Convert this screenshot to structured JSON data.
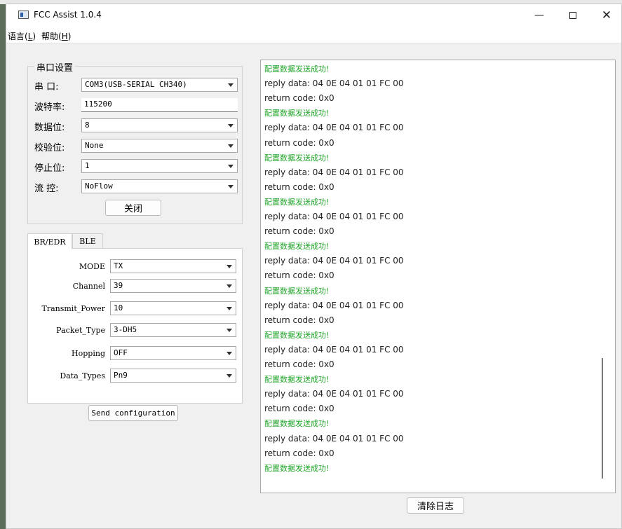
{
  "window": {
    "title": "FCC Assist 1.0.4",
    "controls": {
      "minimize": "—",
      "close": "✕"
    }
  },
  "menu": [
    {
      "label": "语言",
      "accel": "L"
    },
    {
      "label": "帮助",
      "accel": "H"
    }
  ],
  "serial": {
    "group_title": "串口设置",
    "port_label": "串  口:",
    "port_value": "COM3(USB-SERIAL CH340)",
    "baud_label": "波特率:",
    "baud_value": "115200",
    "databits_label": "数据位:",
    "databits_value": "8",
    "parity_label": "校验位:",
    "parity_value": "None",
    "stopbits_label": "停止位:",
    "stopbits_value": "1",
    "flow_label": "流  控:",
    "flow_value": "NoFlow",
    "close_button": "关闭"
  },
  "tabs": [
    {
      "label": "BR/EDR",
      "active": true
    },
    {
      "label": "BLE",
      "active": false
    }
  ],
  "params": [
    {
      "label": "MODE",
      "value": "TX"
    },
    {
      "label": "Channel",
      "value": "39"
    },
    {
      "label": "Transmit_Power",
      "value": "10"
    },
    {
      "label": "Packet_Type",
      "value": "3-DH5"
    },
    {
      "label": "Hopping",
      "value": "OFF"
    },
    {
      "label": "Data_Types",
      "value": "Pn9"
    }
  ],
  "send_button": "Send configuration",
  "clear_button": "清除日志",
  "log": [
    {
      "text": "配置数据发送成功!",
      "kind": "ok"
    },
    {
      "text": "reply data: 04 0E 04 01 01 FC 00",
      "kind": "data"
    },
    {
      "text": "return code: 0x0",
      "kind": "data"
    },
    {
      "text": "配置数据发送成功!",
      "kind": "ok"
    },
    {
      "text": "reply data: 04 0E 04 01 01 FC 00",
      "kind": "data"
    },
    {
      "text": "return code: 0x0",
      "kind": "data"
    },
    {
      "text": "配置数据发送成功!",
      "kind": "ok"
    },
    {
      "text": "reply data: 04 0E 04 01 01 FC 00",
      "kind": "data"
    },
    {
      "text": "return code: 0x0",
      "kind": "data"
    },
    {
      "text": "配置数据发送成功!",
      "kind": "ok"
    },
    {
      "text": "reply data: 04 0E 04 01 01 FC 00",
      "kind": "data"
    },
    {
      "text": "return code: 0x0",
      "kind": "data"
    },
    {
      "text": "配置数据发送成功!",
      "kind": "ok"
    },
    {
      "text": "reply data: 04 0E 04 01 01 FC 00",
      "kind": "data"
    },
    {
      "text": "return code: 0x0",
      "kind": "data"
    },
    {
      "text": "配置数据发送成功!",
      "kind": "ok"
    },
    {
      "text": "reply data: 04 0E 04 01 01 FC 00",
      "kind": "data"
    },
    {
      "text": "return code: 0x0",
      "kind": "data"
    },
    {
      "text": "配置数据发送成功!",
      "kind": "ok"
    },
    {
      "text": "reply data: 04 0E 04 01 01 FC 00",
      "kind": "data"
    },
    {
      "text": "return code: 0x0",
      "kind": "data"
    },
    {
      "text": "配置数据发送成功!",
      "kind": "ok"
    },
    {
      "text": "reply data: 04 0E 04 01 01 FC 00",
      "kind": "data"
    },
    {
      "text": "return code: 0x0",
      "kind": "data"
    },
    {
      "text": "配置数据发送成功!",
      "kind": "ok"
    },
    {
      "text": "reply data: 04 0E 04 01 01 FC 00",
      "kind": "data"
    },
    {
      "text": "return code: 0x0",
      "kind": "data"
    },
    {
      "text": "配置数据发送成功!",
      "kind": "ok"
    }
  ]
}
